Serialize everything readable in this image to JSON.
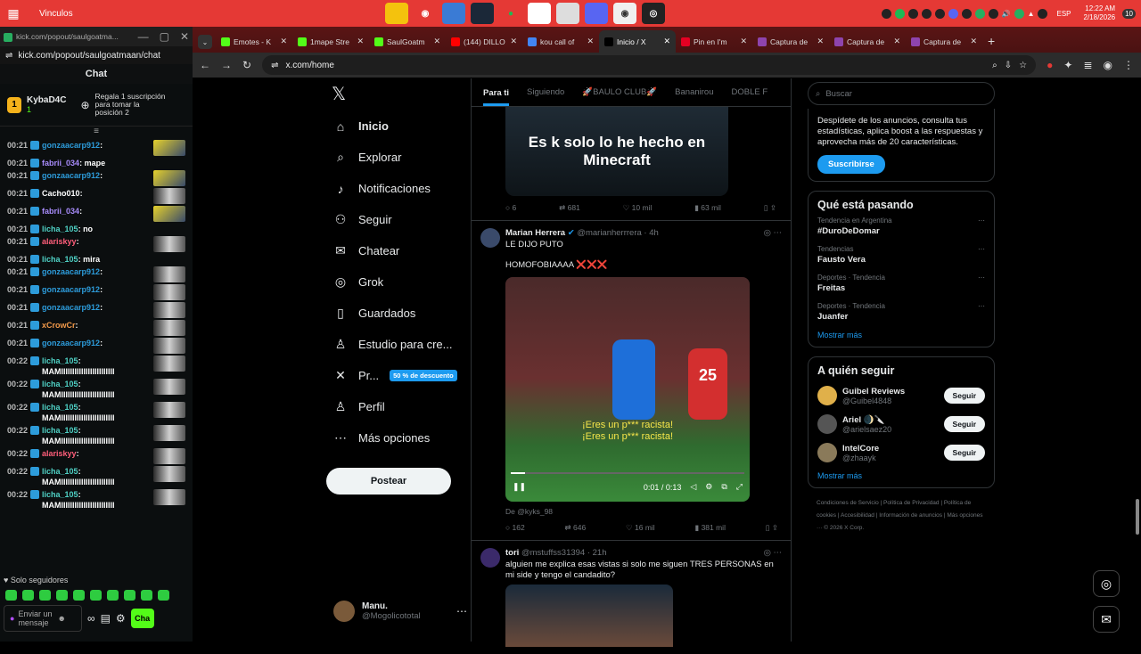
{
  "taskbar": {
    "title": "Vinculos",
    "time": "12:22 AM",
    "date": "2/18/2026",
    "lang": "ESP",
    "notif_count": "10"
  },
  "kick": {
    "url": "kick.com/popout/saulgoatmaan/chat",
    "titlebar": "kick.com/popout/saulgoatma...",
    "chat_title": "Chat",
    "banner_user": "KybaD4C",
    "banner_count": "1",
    "banner_rank": "1",
    "banner_text": "Regala 1 suscripción para tomar la posición 2",
    "messages": [
      {
        "time": "00:21",
        "user": "gonzaacarp912",
        "color": "#2d9cdb",
        "text": "",
        "emote": "y"
      },
      {
        "time": "00:21",
        "user": "fabrii_034",
        "color": "#a78bfa",
        "text": "mape",
        "emote": ""
      },
      {
        "time": "00:21",
        "user": "gonzaacarp912",
        "color": "#2d9cdb",
        "text": "",
        "emote": "y"
      },
      {
        "time": "00:21",
        "user": "Cacho010",
        "color": "#ffffff",
        "text": "",
        "emote": "s"
      },
      {
        "time": "00:21",
        "user": "fabrii_034",
        "color": "#a78bfa",
        "text": "",
        "emote": "y"
      },
      {
        "time": "00:21",
        "user": "licha_105",
        "color": "#4fd1c5",
        "text": "no",
        "emote": ""
      },
      {
        "time": "00:21",
        "user": "alariskyy",
        "color": "#ff5e7a",
        "text": "",
        "emote": "s"
      },
      {
        "time": "00:21",
        "user": "licha_105",
        "color": "#4fd1c5",
        "text": "mira",
        "emote": ""
      },
      {
        "time": "00:21",
        "user": "gonzaacarp912",
        "color": "#2d9cdb",
        "text": "",
        "emote": "s"
      },
      {
        "time": "00:21",
        "user": "gonzaacarp912",
        "color": "#2d9cdb",
        "text": "",
        "emote": "s"
      },
      {
        "time": "00:21",
        "user": "gonzaacarp912",
        "color": "#2d9cdb",
        "text": "",
        "emote": "s"
      },
      {
        "time": "00:21",
        "user": "xCrowCr",
        "color": "#f2994a",
        "text": "",
        "emote": "s"
      },
      {
        "time": "00:21",
        "user": "gonzaacarp912",
        "color": "#2d9cdb",
        "text": "",
        "emote": "s"
      },
      {
        "time": "00:22",
        "user": "licha_105",
        "color": "#4fd1c5",
        "text": "MAMIIIIIIIIIIIIIIIIIIIIIIII",
        "emote": "s"
      },
      {
        "time": "00:22",
        "user": "licha_105",
        "color": "#4fd1c5",
        "text": "MAMIIIIIIIIIIIIIIIIIIIIIIII",
        "emote": "s"
      },
      {
        "time": "00:22",
        "user": "licha_105",
        "color": "#4fd1c5",
        "text": "MAMIIIIIIIIIIIIIIIIIIIIIIII",
        "emote": "s"
      },
      {
        "time": "00:22",
        "user": "licha_105",
        "color": "#4fd1c5",
        "text": "MAMIIIIIIIIIIIIIIIIIIIIIIII",
        "emote": "s"
      },
      {
        "time": "00:22",
        "user": "alariskyy",
        "color": "#ff5e7a",
        "text": "",
        "emote": "s"
      },
      {
        "time": "00:22",
        "user": "licha_105",
        "color": "#4fd1c5",
        "text": "MAMIIIIIIIIIIIIIIIIIIIIIIII",
        "emote": "s"
      },
      {
        "time": "00:22",
        "user": "licha_105",
        "color": "#4fd1c5",
        "text": "MAMIIIIIIIIIIIIIIIIIIIIIIII",
        "emote": "s"
      }
    ],
    "followers_only": "Solo seguidores",
    "input_placeholder": "Enviar un mensaje",
    "chat_button": "Cha"
  },
  "browser": {
    "tabs": [
      {
        "label": "Emotes - K",
        "color": "#53fc18"
      },
      {
        "label": "1mape Stre",
        "color": "#53fc18"
      },
      {
        "label": "SaulGoatm",
        "color": "#53fc18"
      },
      {
        "label": "(144) DILLO",
        "color": "#ff0000"
      },
      {
        "label": "kou call of",
        "color": "#4285f4"
      },
      {
        "label": "Inicio / X",
        "color": "#000000"
      },
      {
        "label": "Pin en I'm",
        "color": "#e60023"
      },
      {
        "label": "Captura de",
        "color": "#8e44ad"
      },
      {
        "label": "Captura de",
        "color": "#8e44ad"
      },
      {
        "label": "Captura de",
        "color": "#8e44ad"
      }
    ],
    "address": "x.com/home"
  },
  "x": {
    "nav": [
      {
        "icon": "⌂",
        "label": "Inicio"
      },
      {
        "icon": "⌕",
        "label": "Explorar"
      },
      {
        "icon": "♪",
        "label": "Notificaciones"
      },
      {
        "icon": "⚇",
        "label": "Seguir"
      },
      {
        "icon": "✉",
        "label": "Chatear"
      },
      {
        "icon": "◎",
        "label": "Grok"
      },
      {
        "icon": "▯",
        "label": "Guardados"
      },
      {
        "icon": "♙",
        "label": "Estudio para cre..."
      },
      {
        "icon": "✕",
        "label": "Pr..."
      },
      {
        "icon": "♙",
        "label": "Perfil"
      },
      {
        "icon": "⋯",
        "label": "Más opciones"
      }
    ],
    "premium_badge": "50 % de descuento",
    "post_button": "Postear",
    "account_name": "Manu.",
    "account_handle": "@Mogolicototal",
    "feed_tabs": [
      "Para ti",
      "Siguiendo",
      "🚀BAULO CLUB🚀",
      "Bananirou",
      "DOBLE F"
    ],
    "post1": {
      "caption": "Es k solo lo he hecho en Minecraft",
      "replies": "6",
      "reposts": "681",
      "likes": "10 mil",
      "views": "63 mil"
    },
    "post2": {
      "name": "Marian Herrera",
      "handle": "@marianherrrera · 4h",
      "text1": "LE DIJO PUTO",
      "text2": "HOMOFOBIAAAA ❌❌❌",
      "subtitle": "¡Eres un p*** racista!",
      "time": "0:01 / 0:13",
      "from": "De @kyks_98",
      "replies": "162",
      "reposts": "646",
      "likes": "16 mil",
      "views": "381 mil",
      "number": "25"
    },
    "post3": {
      "name": "tori",
      "handle": "@mstuffss31394 · 21h",
      "text": "alguien me explica esas vistas si solo me siguen TRES PERSONAS en mi side y tengo el candadito?"
    },
    "search_placeholder": "Buscar",
    "premium_text": "Despídete de los anuncios, consulta tus estadísticas, aplica boost a las respuestas y aprovecha más de 20 características.",
    "subscribe": "Suscribirse",
    "trending_title": "Qué está pasando",
    "trends": [
      {
        "ctx": "Tendencia en Argentina",
        "name": "#DuroDeDomar"
      },
      {
        "ctx": "Tendencias",
        "name": "Fausto Vera"
      },
      {
        "ctx": "Deportes · Tendencia",
        "name": "Freitas"
      },
      {
        "ctx": "Deportes · Tendencia",
        "name": "Juanfer"
      }
    ],
    "show_more": "Mostrar más",
    "who_title": "A quién seguir",
    "who": [
      {
        "name": "Guibel Reviews",
        "handle": "@Guibel4848"
      },
      {
        "name": "Ariel 🌒🔪",
        "handle": "@arielsaez20"
      },
      {
        "name": "IntelCore",
        "handle": "@zhaayk"
      }
    ],
    "follow_label": "Seguir",
    "footer": "Condiciones de Servicio | Política de Privacidad | Política de cookies | Accesibilidad | Información de anuncios | Más opciones ··· © 2026 X Corp."
  }
}
